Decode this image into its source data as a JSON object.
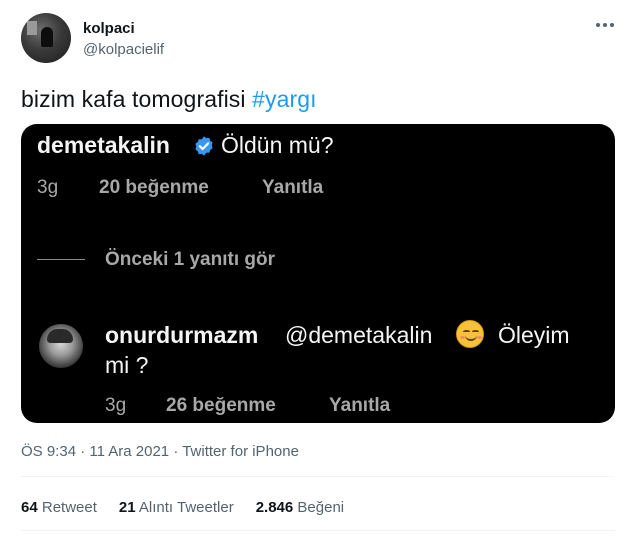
{
  "tweet": {
    "author_name": "kolpaci",
    "author_handle": "@kolpacielif",
    "text_plain": "bizim kafa tomografisi ",
    "hashtag": "#yargı",
    "meta": "ÖS 9:34 · 11 Ara 2021 · Twitter for iPhone",
    "accent_color": "#1d9bf0"
  },
  "media": {
    "comment1": {
      "user": "demetakalin",
      "text": "Öldün mü?",
      "time": "3g",
      "likes": "20 beğenme",
      "reply": "Yanıtla"
    },
    "view_previous": "Önceki 1 yanıtı gör",
    "comment2": {
      "user": "onurdurmazm",
      "mention": "@demetakalin",
      "text_after_emoji": "Öleyim",
      "text_line2": "mi ?",
      "time": "3g",
      "likes": "26 beğenme",
      "reply": "Yanıtla"
    }
  },
  "stats": {
    "retweets_count": "64",
    "retweets_label": "Retweet",
    "quotes_count": "21",
    "quotes_label": "Alıntı Tweetler",
    "likes_count": "2.846",
    "likes_label": "Beğeni"
  },
  "icons": {
    "more": "more-horizontal-icon",
    "verified": "verified-badge-icon",
    "emoji": "smiling-face-emoji"
  }
}
